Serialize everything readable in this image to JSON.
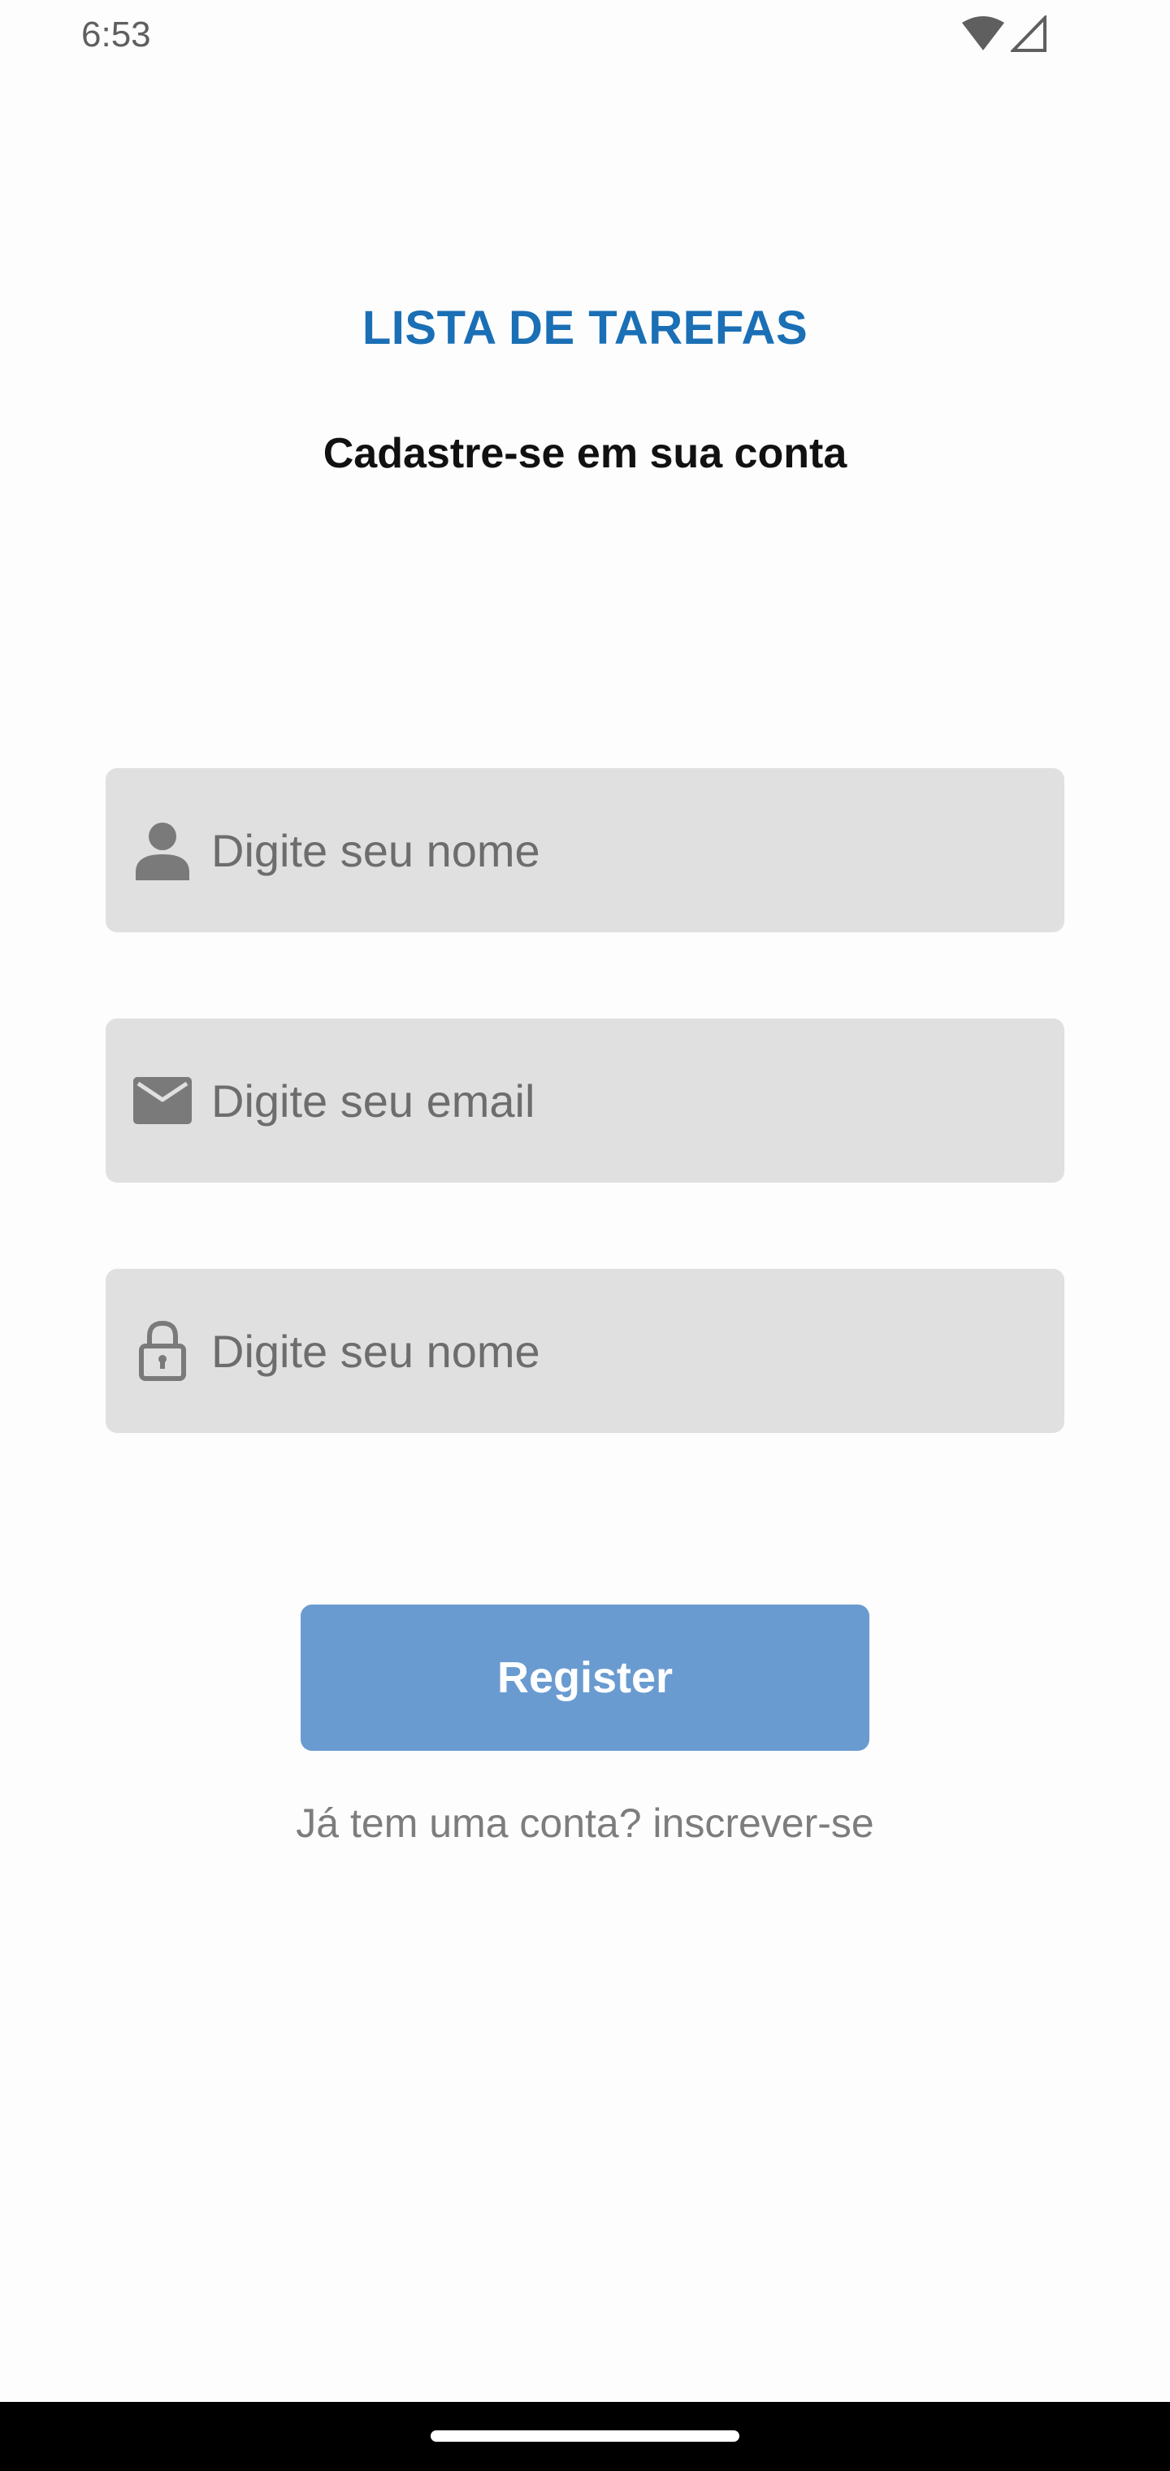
{
  "status_bar": {
    "time": "6:53",
    "icons": [
      "wifi-icon",
      "cell-signal-icon"
    ]
  },
  "header": {
    "title": "LISTA DE TAREFAS",
    "subtitle": "Cadastre-se em sua conta"
  },
  "form": {
    "name_field": {
      "placeholder": "Digite seu nome",
      "value": "",
      "icon": "person-icon"
    },
    "email_field": {
      "placeholder": "Digite seu email",
      "value": "",
      "icon": "mail-icon"
    },
    "password_field": {
      "placeholder": "Digite seu nome",
      "value": "",
      "icon": "lock-icon"
    },
    "register_label": "Register",
    "login_link": "Já tem uma conta? inscrever-se"
  },
  "colors": {
    "title": "#1a6fb5",
    "button": "#6a9bd0",
    "field_background": "#e0e0e0",
    "icon": "#7a7a7a"
  }
}
